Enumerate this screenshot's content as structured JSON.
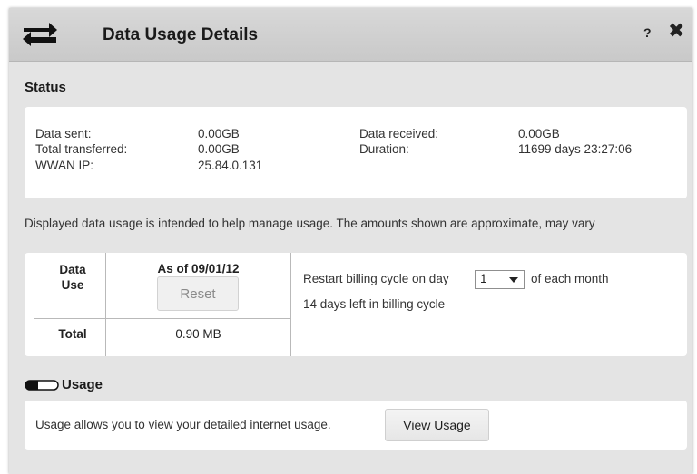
{
  "dialog": {
    "title": "Data Usage Details",
    "help_label": "?",
    "close_label": "✖"
  },
  "status": {
    "heading": "Status",
    "rows": [
      {
        "label": "Data sent:",
        "value": "0.00GB"
      },
      {
        "label": "Total transferred:",
        "value": "0.00GB"
      },
      {
        "label": "WWAN IP:",
        "value": "25.84.0.131"
      },
      {
        "label": "Data received:",
        "value": "0.00GB"
      },
      {
        "label": "Duration:",
        "value": "11699 days 23:27:06"
      }
    ]
  },
  "note": "Displayed data usage is intended to help manage usage. The amounts shown are approximate, may vary",
  "data_use": {
    "row_header_line1": "Data",
    "row_header_line2": "Use",
    "as_of": "As of 09/01/12",
    "reset_label": "Reset",
    "total_label": "Total",
    "total_value": "0.90 MB"
  },
  "billing": {
    "restart_prefix": "Restart billing cycle on day",
    "selected_day": "1",
    "restart_suffix": "of each month",
    "days_left": "14 days left in billing cycle"
  },
  "usage": {
    "heading": "Usage",
    "description": "Usage allows you to view your detailed internet usage.",
    "view_button": "View Usage"
  }
}
